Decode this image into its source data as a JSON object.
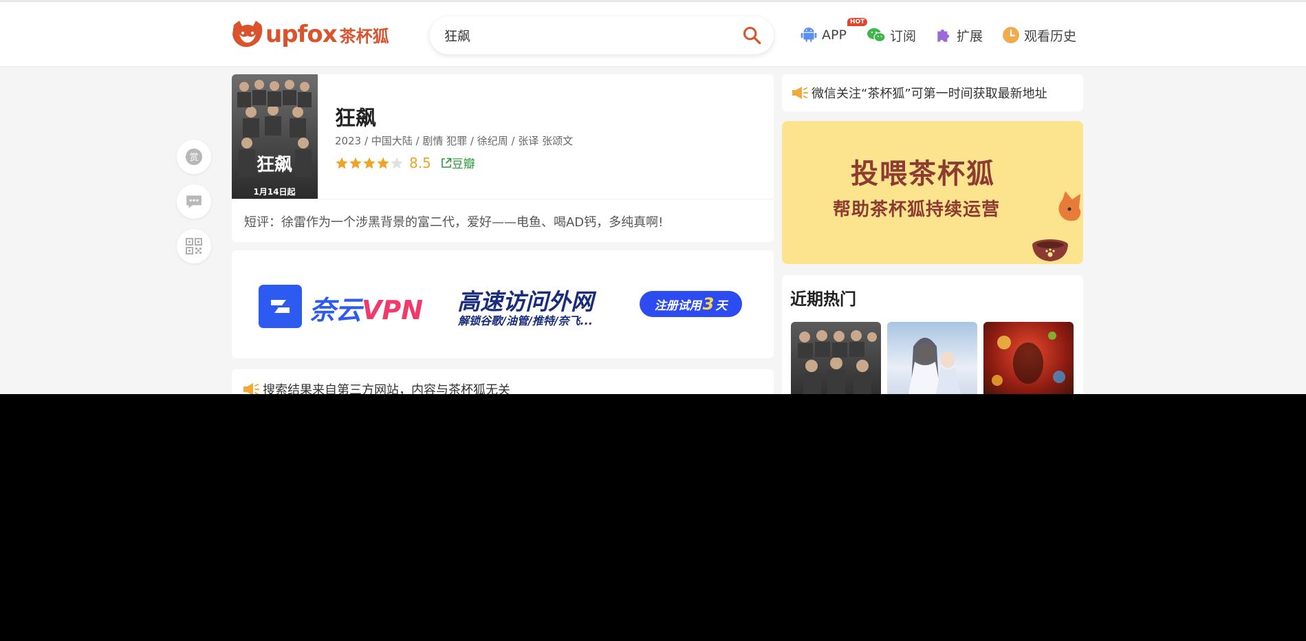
{
  "header": {
    "logo": {
      "text": "upfox",
      "cn": "茶杯狐"
    },
    "search": {
      "value": "狂飙",
      "placeholder": ""
    },
    "nav": [
      {
        "label": "APP",
        "badge": "HOT",
        "icon": "android-icon"
      },
      {
        "label": "订阅",
        "icon": "wechat-icon"
      },
      {
        "label": "扩展",
        "icon": "puzzle-icon"
      },
      {
        "label": "观看历史",
        "icon": "clock-icon"
      }
    ]
  },
  "side": {
    "reward_label": "赏"
  },
  "movie": {
    "title": "狂飙",
    "meta": "2023 / 中国大陆 / 剧情 犯罪 / 徐纪周 / 张译 张颂文",
    "score": "8.5",
    "stars": 4,
    "douban": "豆瓣",
    "review": "短评：徐雷作为一个涉黑背景的富二代，爱好——电鱼、喝AD钙，多纯真啊!",
    "poster_caption": "1月14日起",
    "poster_title": "狂飙"
  },
  "ad": {
    "brand_prefix": "奈云",
    "brand_suffix": "VPN",
    "headline": "高速访问外网",
    "subline": "解锁谷歌/油管/推特/奈飞...",
    "cta_prefix": "注册试用",
    "cta_number": "3",
    "cta_suffix": "天"
  },
  "notices": {
    "search_source": "搜索结果来自第三方网站，内容与茶杯狐无关",
    "wechat": "微信关注“茶杯狐”可第一时间获取最新地址"
  },
  "donate": {
    "line1": "投喂茶杯狐",
    "line2": "帮助茶杯狐持续运营"
  },
  "hot": {
    "title": "近期热门"
  },
  "colors": {
    "brand": "#d9532c",
    "score": "#f1a325",
    "douban": "#2b9939",
    "vpn": "#2d5af0",
    "donate_bg": "#fce38e"
  }
}
